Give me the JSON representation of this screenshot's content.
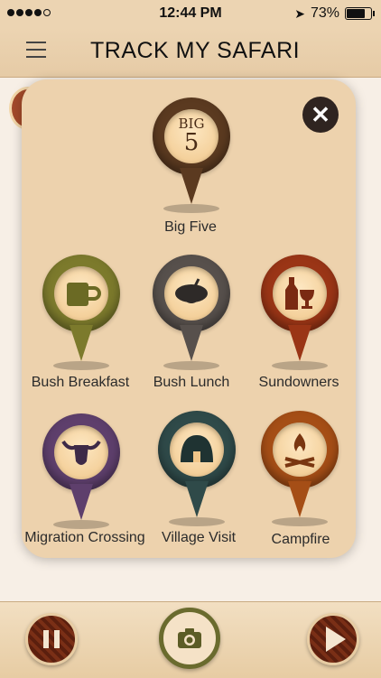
{
  "statusbar": {
    "time": "12:44 PM",
    "battery": "73%"
  },
  "navbar": {
    "title": "TRACK MY SAFARI"
  },
  "panel": {
    "close_icon": "close-icon",
    "big_five": {
      "label": "Big Five",
      "badge_top": "BIG",
      "badge_bottom": "5"
    },
    "categories": [
      {
        "label": "Bush Breakfast",
        "icon": "mug-icon",
        "color": "#7c7a2c"
      },
      {
        "label": "Bush Lunch",
        "icon": "pot-icon",
        "color": "#57504c"
      },
      {
        "label": "Sundowners",
        "icon": "wine-icon",
        "color": "#9a3516"
      },
      {
        "label": "Migration Crossing",
        "icon": "wildebeest-icon",
        "color": "#5e3f6c"
      },
      {
        "label": "Village Visit",
        "icon": "hut-icon",
        "color": "#2f4a49"
      },
      {
        "label": "Campfire",
        "icon": "campfire-icon",
        "color": "#a54e16"
      }
    ]
  },
  "bottombar": {
    "pause_icon": "pause-icon",
    "camera_icon": "camera-icon",
    "play_icon": "play-icon"
  }
}
